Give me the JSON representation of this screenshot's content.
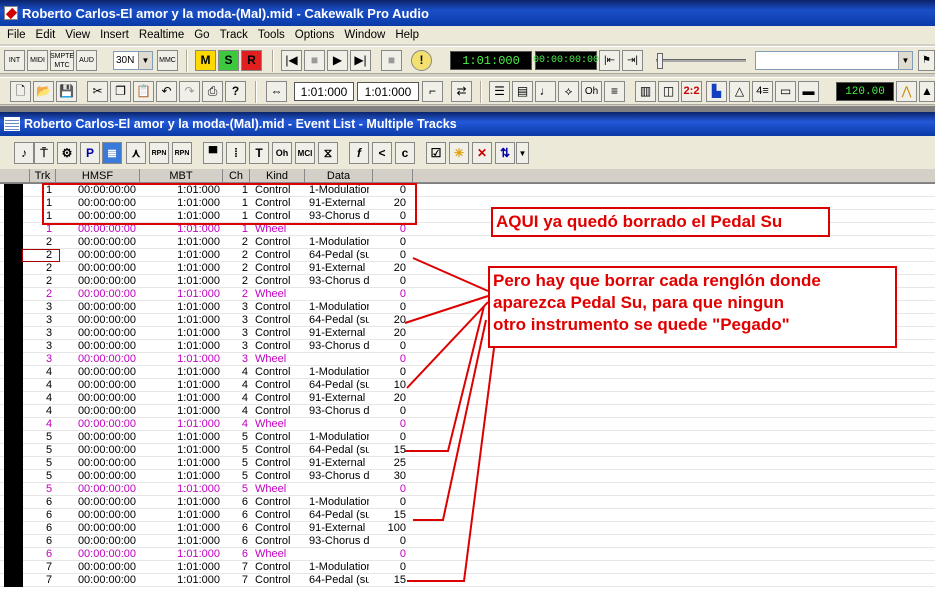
{
  "window": {
    "title": "Roberto Carlos-El amor y la moda-(Mal).mid - Cakewalk Pro Audio"
  },
  "menu": [
    "File",
    "Edit",
    "View",
    "Insert",
    "Realtime",
    "Go",
    "Track",
    "Tools",
    "Options",
    "Window",
    "Help"
  ],
  "toolbar1": {
    "int_label": "INT",
    "midi_label": "MIDI",
    "smpte_label": "SMPTE MTC",
    "aud_label": "AUD",
    "tempo_ratio": "30N",
    "mmc_label": "MMC",
    "m_label": "M",
    "s_label": "S",
    "r_label": "R",
    "time_mbt": "1:01:000",
    "time_hmsf": "00:00:00:00",
    "track_combo": ""
  },
  "toolbar2": {
    "from_time": "1:01:000",
    "thru_time": "1:01:000",
    "meter": "2:2",
    "tempo": "120.00"
  },
  "event_window": {
    "title": "Roberto Carlos-El amor y la moda-(Mal).mid - Event List - Multiple Tracks",
    "tool_labels": [
      "P",
      "RPN",
      "RPN",
      "T",
      "Oh",
      "MCI",
      "f",
      "<",
      "c"
    ],
    "columns": [
      "Trk",
      "HMSF",
      "MBT",
      "Ch",
      "Kind",
      "Data"
    ],
    "rows": [
      {
        "trk": "1",
        "hmsf": "00:00:00:00",
        "mbt": "1:01:000",
        "ch": "1",
        "kind": "Control",
        "data": "1-Modulation",
        "val": "0",
        "type": "control"
      },
      {
        "trk": "1",
        "hmsf": "00:00:00:00",
        "mbt": "1:01:000",
        "ch": "1",
        "kind": "Control",
        "data": "91-External E",
        "val": "20",
        "type": "control"
      },
      {
        "trk": "1",
        "hmsf": "00:00:00:00",
        "mbt": "1:01:000",
        "ch": "1",
        "kind": "Control",
        "data": "93-Chorus de",
        "val": "0",
        "type": "control"
      },
      {
        "trk": "1",
        "hmsf": "00:00:00:00",
        "mbt": "1:01:000",
        "ch": "1",
        "kind": "Wheel",
        "data": "",
        "val": "0",
        "type": "wheel"
      },
      {
        "trk": "2",
        "hmsf": "00:00:00:00",
        "mbt": "1:01:000",
        "ch": "2",
        "kind": "Control",
        "data": "1-Modulation",
        "val": "0",
        "type": "control"
      },
      {
        "trk": "2",
        "hmsf": "00:00:00:00",
        "mbt": "1:01:000",
        "ch": "2",
        "kind": "Control",
        "data": "64-Pedal (su",
        "val": "0",
        "type": "control"
      },
      {
        "trk": "2",
        "hmsf": "00:00:00:00",
        "mbt": "1:01:000",
        "ch": "2",
        "kind": "Control",
        "data": "91-External E",
        "val": "20",
        "type": "control"
      },
      {
        "trk": "2",
        "hmsf": "00:00:00:00",
        "mbt": "1:01:000",
        "ch": "2",
        "kind": "Control",
        "data": "93-Chorus de",
        "val": "0",
        "type": "control"
      },
      {
        "trk": "2",
        "hmsf": "00:00:00:00",
        "mbt": "1:01:000",
        "ch": "2",
        "kind": "Wheel",
        "data": "",
        "val": "0",
        "type": "wheel"
      },
      {
        "trk": "3",
        "hmsf": "00:00:00:00",
        "mbt": "1:01:000",
        "ch": "3",
        "kind": "Control",
        "data": "1-Modulation",
        "val": "0",
        "type": "control"
      },
      {
        "trk": "3",
        "hmsf": "00:00:00:00",
        "mbt": "1:01:000",
        "ch": "3",
        "kind": "Control",
        "data": "64-Pedal (su",
        "val": "20",
        "type": "control"
      },
      {
        "trk": "3",
        "hmsf": "00:00:00:00",
        "mbt": "1:01:000",
        "ch": "3",
        "kind": "Control",
        "data": "91-External E",
        "val": "20",
        "type": "control"
      },
      {
        "trk": "3",
        "hmsf": "00:00:00:00",
        "mbt": "1:01:000",
        "ch": "3",
        "kind": "Control",
        "data": "93-Chorus de",
        "val": "0",
        "type": "control"
      },
      {
        "trk": "3",
        "hmsf": "00:00:00:00",
        "mbt": "1:01:000",
        "ch": "3",
        "kind": "Wheel",
        "data": "",
        "val": "0",
        "type": "wheel"
      },
      {
        "trk": "4",
        "hmsf": "00:00:00:00",
        "mbt": "1:01:000",
        "ch": "4",
        "kind": "Control",
        "data": "1-Modulation",
        "val": "0",
        "type": "control"
      },
      {
        "trk": "4",
        "hmsf": "00:00:00:00",
        "mbt": "1:01:000",
        "ch": "4",
        "kind": "Control",
        "data": "64-Pedal (su",
        "val": "10",
        "type": "control"
      },
      {
        "trk": "4",
        "hmsf": "00:00:00:00",
        "mbt": "1:01:000",
        "ch": "4",
        "kind": "Control",
        "data": "91-External E",
        "val": "20",
        "type": "control"
      },
      {
        "trk": "4",
        "hmsf": "00:00:00:00",
        "mbt": "1:01:000",
        "ch": "4",
        "kind": "Control",
        "data": "93-Chorus de",
        "val": "0",
        "type": "control"
      },
      {
        "trk": "4",
        "hmsf": "00:00:00:00",
        "mbt": "1:01:000",
        "ch": "4",
        "kind": "Wheel",
        "data": "",
        "val": "0",
        "type": "wheel"
      },
      {
        "trk": "5",
        "hmsf": "00:00:00:00",
        "mbt": "1:01:000",
        "ch": "5",
        "kind": "Control",
        "data": "1-Modulation",
        "val": "0",
        "type": "control"
      },
      {
        "trk": "5",
        "hmsf": "00:00:00:00",
        "mbt": "1:01:000",
        "ch": "5",
        "kind": "Control",
        "data": "64-Pedal (su",
        "val": "15",
        "type": "control"
      },
      {
        "trk": "5",
        "hmsf": "00:00:00:00",
        "mbt": "1:01:000",
        "ch": "5",
        "kind": "Control",
        "data": "91-External E",
        "val": "25",
        "type": "control"
      },
      {
        "trk": "5",
        "hmsf": "00:00:00:00",
        "mbt": "1:01:000",
        "ch": "5",
        "kind": "Control",
        "data": "93-Chorus de",
        "val": "30",
        "type": "control"
      },
      {
        "trk": "5",
        "hmsf": "00:00:00:00",
        "mbt": "1:01:000",
        "ch": "5",
        "kind": "Wheel",
        "data": "",
        "val": "0",
        "type": "wheel"
      },
      {
        "trk": "6",
        "hmsf": "00:00:00:00",
        "mbt": "1:01:000",
        "ch": "6",
        "kind": "Control",
        "data": "1-Modulation",
        "val": "0",
        "type": "control"
      },
      {
        "trk": "6",
        "hmsf": "00:00:00:00",
        "mbt": "1:01:000",
        "ch": "6",
        "kind": "Control",
        "data": "64-Pedal (su",
        "val": "15",
        "type": "control"
      },
      {
        "trk": "6",
        "hmsf": "00:00:00:00",
        "mbt": "1:01:000",
        "ch": "6",
        "kind": "Control",
        "data": "91-External E",
        "val": "100",
        "type": "control"
      },
      {
        "trk": "6",
        "hmsf": "00:00:00:00",
        "mbt": "1:01:000",
        "ch": "6",
        "kind": "Control",
        "data": "93-Chorus de",
        "val": "0",
        "type": "control"
      },
      {
        "trk": "6",
        "hmsf": "00:00:00:00",
        "mbt": "1:01:000",
        "ch": "6",
        "kind": "Wheel",
        "data": "",
        "val": "0",
        "type": "wheel"
      },
      {
        "trk": "7",
        "hmsf": "00:00:00:00",
        "mbt": "1:01:000",
        "ch": "7",
        "kind": "Control",
        "data": "1-Modulation",
        "val": "0",
        "type": "control"
      },
      {
        "trk": "7",
        "hmsf": "00:00:00:00",
        "mbt": "1:01:000",
        "ch": "7",
        "kind": "Control",
        "data": "64-Pedal (su",
        "val": "15",
        "type": "control"
      }
    ]
  },
  "annotations": {
    "note1": "AQUI ya quedó borrado el Pedal Su",
    "note2_lines": [
      "Pero hay que borrar cada renglón donde",
      "aparezca Pedal Su,  para que ningun",
      "otro instrumento se quede \"Pegado\""
    ],
    "color": "#e00000"
  }
}
